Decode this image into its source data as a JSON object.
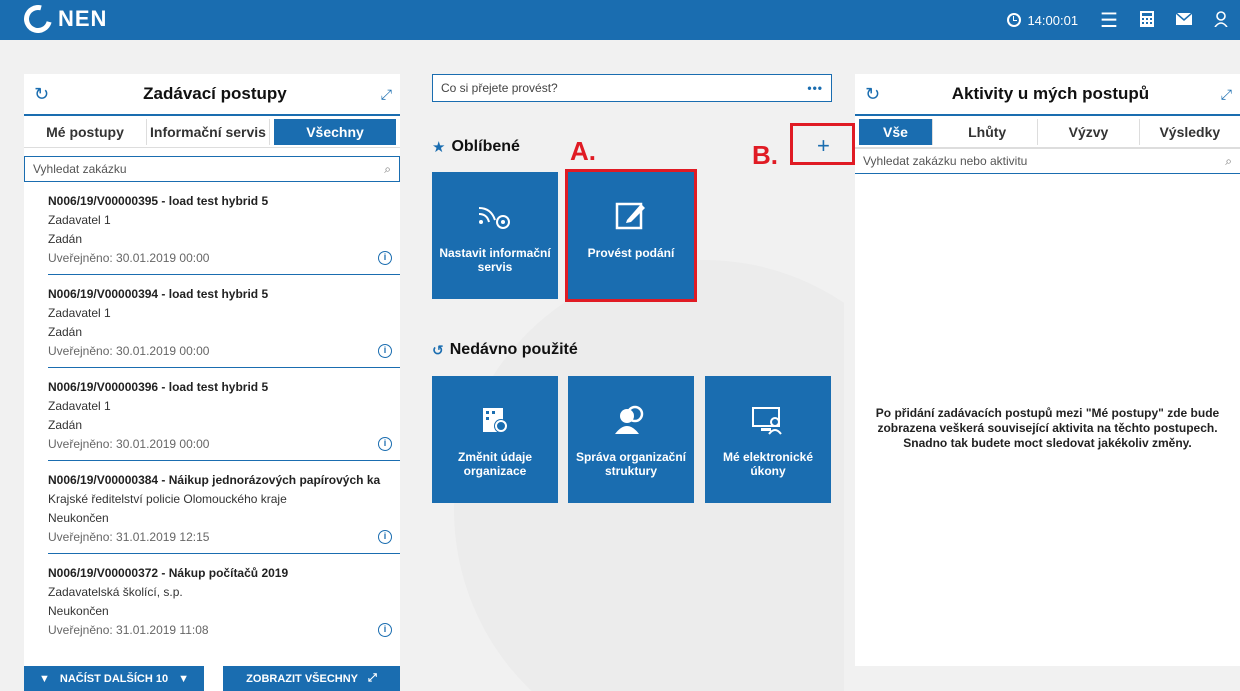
{
  "header": {
    "logo": "NEN",
    "time": "14:00:01"
  },
  "left_panel": {
    "title": "Zadávací postupy",
    "tabs": [
      "Mé postupy",
      "Informační servis",
      "Všechny"
    ],
    "search_placeholder": "Vyhledat zakázku",
    "items": [
      {
        "title": "N006/19/V00000395 - load test hybrid 5",
        "submitter": "Zadavatel 1",
        "status": "Zadán",
        "published": "Uveřejněno: 30.01.2019 00:00"
      },
      {
        "title": "N006/19/V00000394 - load test hybrid 5",
        "submitter": "Zadavatel 1",
        "status": "Zadán",
        "published": "Uveřejněno: 30.01.2019 00:00"
      },
      {
        "title": "N006/19/V00000396 - load test hybrid 5",
        "submitter": "Zadavatel 1",
        "status": "Zadán",
        "published": "Uveřejněno: 30.01.2019 00:00"
      },
      {
        "title": "N006/19/V00000384 - Náikup jednorázových papírových ka",
        "submitter": "Krajské ředitelství policie Olomouckého kraje",
        "status": "Neukončen",
        "published": "Uveřejněno: 31.01.2019 12:15"
      },
      {
        "title": "N006/19/V00000372 - Nákup počítačů 2019",
        "submitter": "Zadavatelská školící, s.p.",
        "status": "Neukončen",
        "published": "Uveřejněno: 31.01.2019 11:08"
      }
    ],
    "load_more": "NAČÍST DALŠÍCH 10",
    "show_all": "ZOBRAZIT VŠECHNY"
  },
  "middle": {
    "wish_placeholder": "Co si přejete provést?",
    "favorites_title": "Oblíbené",
    "favorites": [
      {
        "label": "Nastavit informační servis"
      },
      {
        "label": "Provést podání"
      }
    ],
    "recent_title": "Nedávno použité",
    "recent": [
      {
        "label": "Změnit údaje organizace"
      },
      {
        "label": "Správa organizační struktury"
      },
      {
        "label": "Mé elektronické úkony"
      }
    ],
    "annotation_a": "A.",
    "annotation_b": "B."
  },
  "right_panel": {
    "title": "Aktivity u mých postupů",
    "tabs": [
      "Vše",
      "Lhůty",
      "Výzvy",
      "Výsledky"
    ],
    "search_placeholder": "Vyhledat zakázku nebo aktivitu",
    "empty_message": "Po přidání zadávacích postupů mezi \"Mé postupy\" zde bude zobrazena veškerá související aktivita na těchto postupech. Snadno tak budete moct sledovat jakékoliv změny."
  },
  "colors": {
    "brand": "#1a6db0",
    "annotation": "#e01b24"
  }
}
